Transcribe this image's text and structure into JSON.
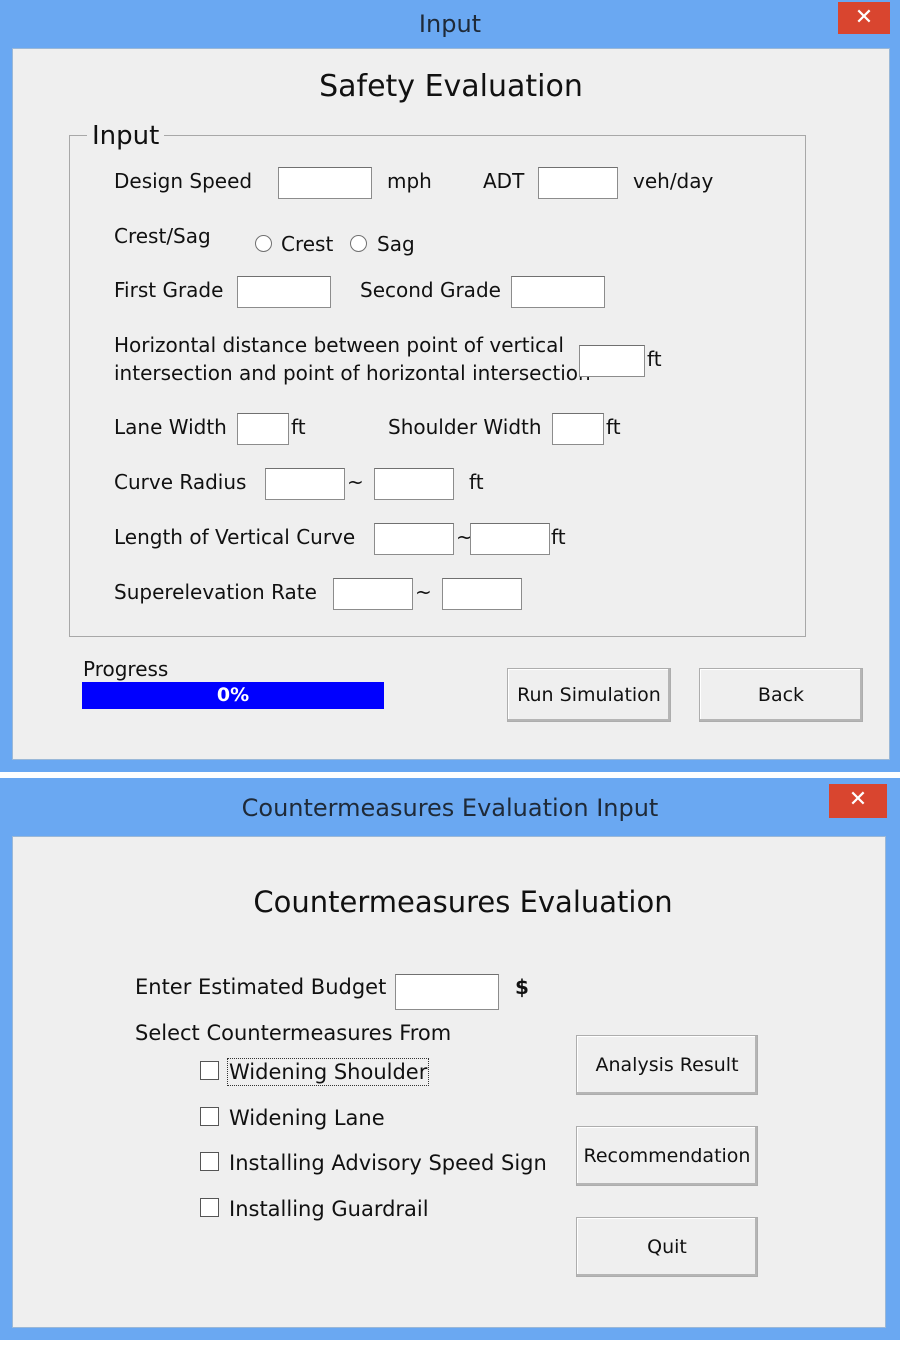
{
  "input_window": {
    "title": "Input",
    "close_glyph": "✕",
    "heading": "Safety Evaluation",
    "group_label": "Input",
    "design_speed_label": "Design Speed",
    "design_speed_value": "",
    "design_speed_unit": "mph",
    "adt_label": "ADT",
    "adt_value": "",
    "adt_unit": "veh/day",
    "crest_sag_label": "Crest/Sag",
    "crest_option": "Crest",
    "sag_option": "Sag",
    "first_grade_label": "First Grade",
    "second_grade_label": "Second Grade",
    "horiz_distance_line1": "Horizontal distance between point of vertical",
    "horiz_distance_line2": "intersection and point of horizontal intersection",
    "horiz_distance_unit": "ft",
    "lane_width_label": "Lane Width",
    "lane_width_unit": "ft",
    "shoulder_width_label": "Shoulder Width",
    "shoulder_width_unit": "ft",
    "curve_radius_label": "Curve Radius",
    "curve_radius_sep": "~",
    "curve_radius_unit": "ft",
    "vertical_curve_label": "Length of Vertical Curve",
    "vertical_curve_sep": "~",
    "vertical_curve_unit": "ft",
    "superelevation_label": "Superelevation Rate",
    "superelevation_sep": "~",
    "progress_label": "Progress",
    "progress_text": "0%",
    "progress_fraction": 0,
    "run_button": "Run Simulation",
    "back_button": "Back"
  },
  "countermeasures_window": {
    "title": "Countermeasures Evaluation Input",
    "close_glyph": "✕",
    "heading": "Countermeasures Evaluation",
    "budget_label": "Enter Estimated Budget",
    "budget_value": "",
    "budget_unit": "$",
    "select_label": "Select Countermeasures From",
    "options": [
      {
        "label": "Widening Shoulder",
        "checked": false
      },
      {
        "label": "Widening Lane",
        "checked": false
      },
      {
        "label": "Installing Advisory Speed Sign",
        "checked": false
      },
      {
        "label": "Installing Guardrail",
        "checked": false
      }
    ],
    "analysis_button": "Analysis Result",
    "recommendation_button": "Recommendation",
    "quit_button": "Quit"
  },
  "colors": {
    "titlebar": "#6aa8f2",
    "close": "#d9452f",
    "progress": "#0000ff",
    "client": "#efefef"
  }
}
